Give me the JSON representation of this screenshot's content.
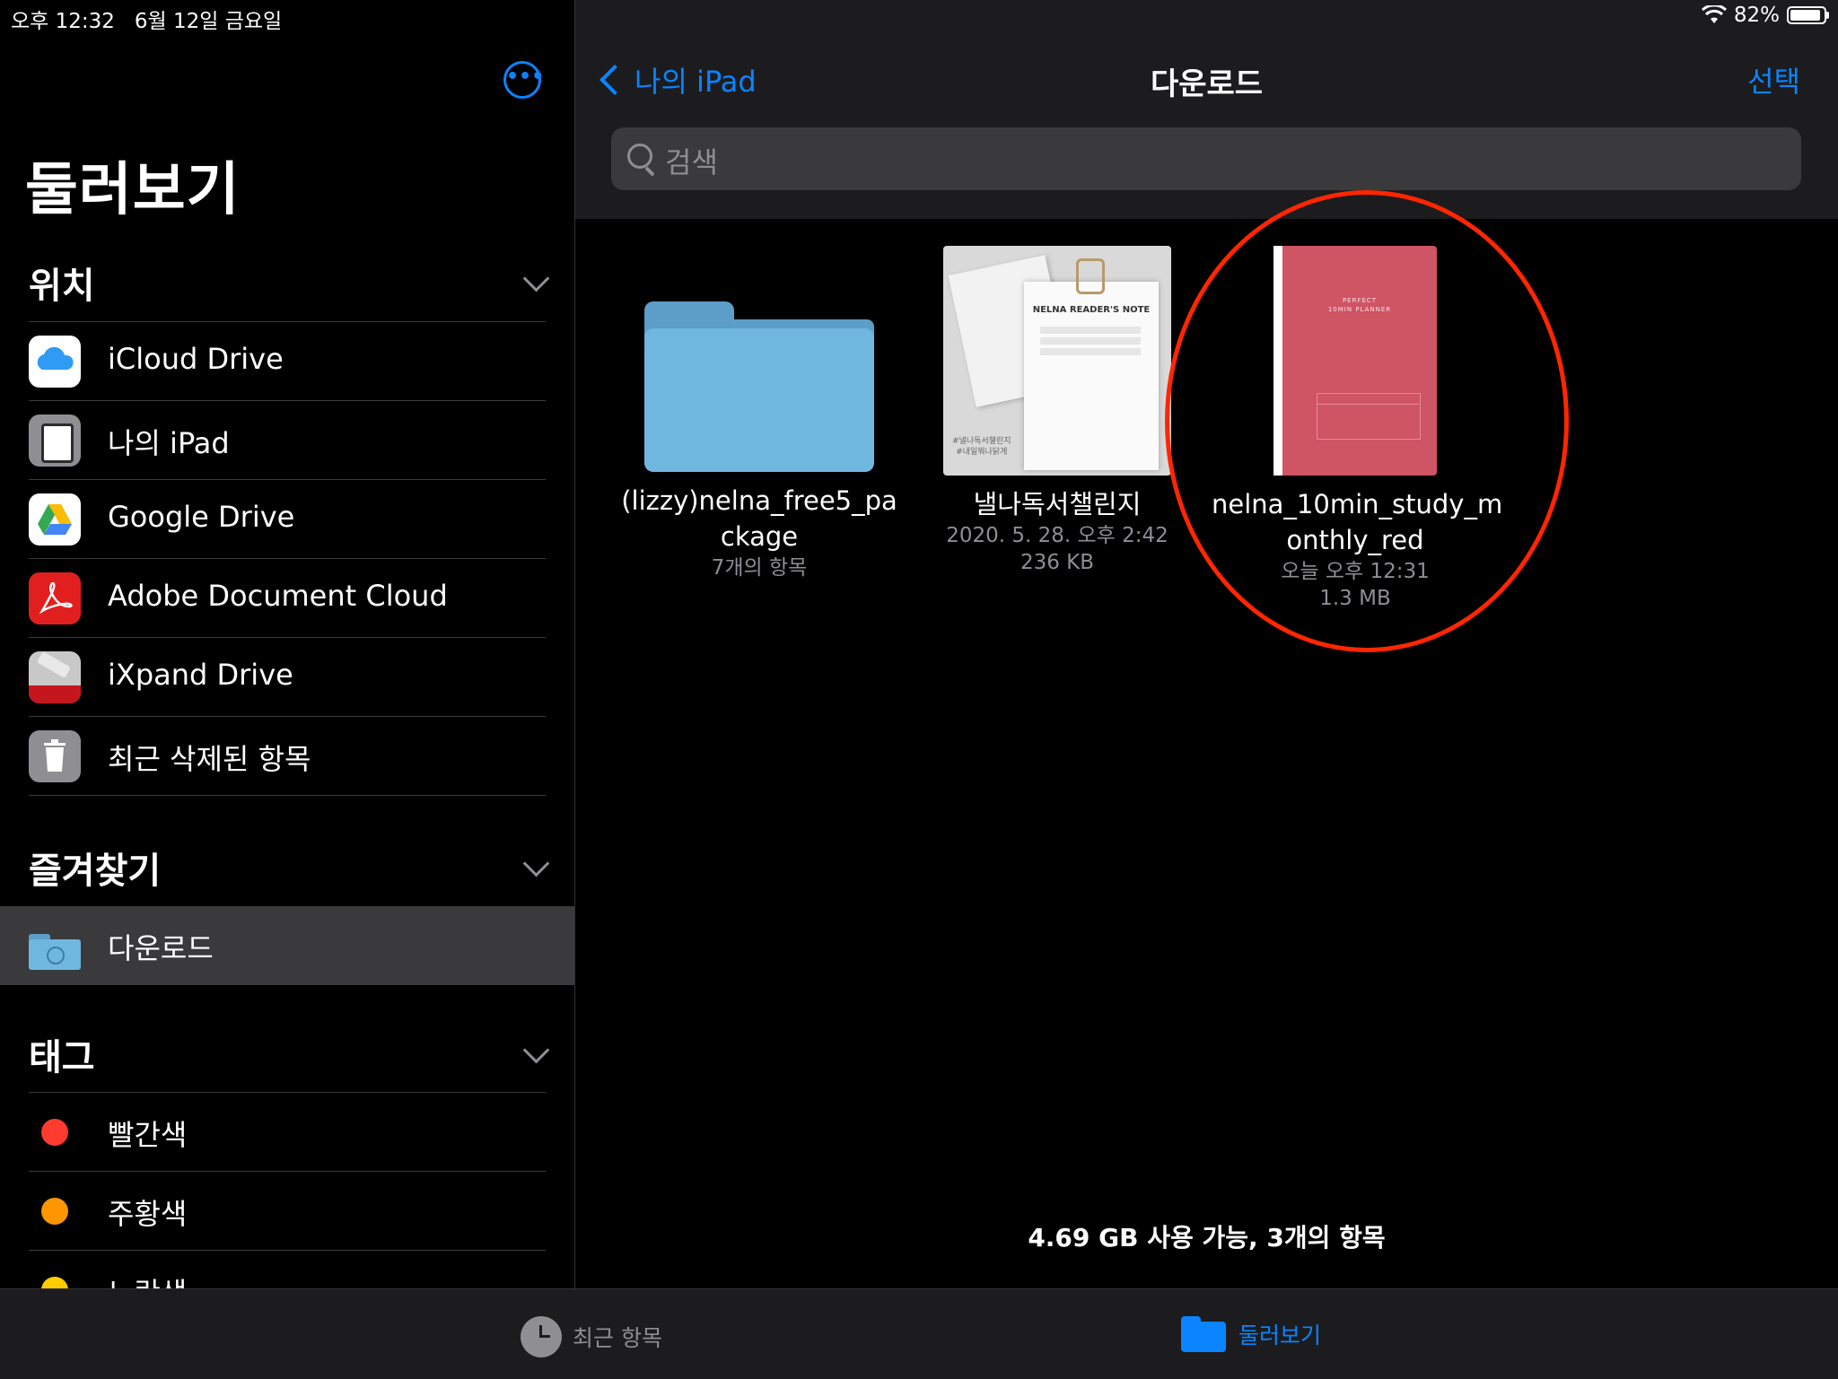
{
  "status": {
    "time": "오후 12:32",
    "date": "6월 12일 금요일",
    "battery": "82%",
    "battery_level": 0.82
  },
  "sidebar": {
    "title": "둘러보기",
    "sections": {
      "locations": {
        "header": "위치",
        "items": [
          {
            "label": "iCloud Drive",
            "icon": "icloud-icon"
          },
          {
            "label": "나의 iPad",
            "icon": "ipad-icon"
          },
          {
            "label": "Google Drive",
            "icon": "google-drive-icon"
          },
          {
            "label": "Adobe Document Cloud",
            "icon": "adobe-icon"
          },
          {
            "label": "iXpand Drive",
            "icon": "ixpand-icon"
          },
          {
            "label": "최근 삭제된 항목",
            "icon": "trash-icon"
          }
        ]
      },
      "favorites": {
        "header": "즐겨찾기",
        "items": [
          {
            "label": "다운로드",
            "icon": "download-folder-icon",
            "selected": true
          }
        ]
      },
      "tags": {
        "header": "태그",
        "items": [
          {
            "label": "빨간색",
            "color": "#ff3b30"
          },
          {
            "label": "주황색",
            "color": "#ff9500"
          },
          {
            "label": "노란색",
            "color": "#ffcc00"
          }
        ]
      }
    }
  },
  "main": {
    "back_label": "나의 iPad",
    "title": "다운로드",
    "select_label": "선택",
    "search_placeholder": "검색",
    "files": [
      {
        "name_line1": "(lizzy)nelna_free5_pa",
        "name_line2": "ckage",
        "meta1": "7개의 항목",
        "meta2": "",
        "thumb": "folder"
      },
      {
        "name_line1": "낼나독서챌린지",
        "name_line2": "",
        "meta1": "2020. 5. 28. 오후 2:42",
        "meta2": "236 KB",
        "thumb": "reader-note",
        "thumb_text": {
          "title": "NELNA READER'S NOTE",
          "caption1": "#낼나독서챌린지",
          "caption2": "#내일뭐나닭게"
        }
      },
      {
        "name_line1": "nelna_10min_study_m",
        "name_line2": "onthly_red",
        "meta1": "오늘 오후 12:31",
        "meta2": "1.3 MB",
        "thumb": "red-planner",
        "thumb_text": {
          "line1": "PERFECT",
          "line2": "10MIN PLANNER"
        }
      }
    ],
    "storage_text": "4.69 GB 사용 가능, 3개의 항목"
  },
  "tabbar": {
    "recent_label": "최근 항목",
    "browse_label": "둘러보기"
  },
  "colors": {
    "accent": "#0a84ff",
    "annotation": "#ff2600"
  }
}
